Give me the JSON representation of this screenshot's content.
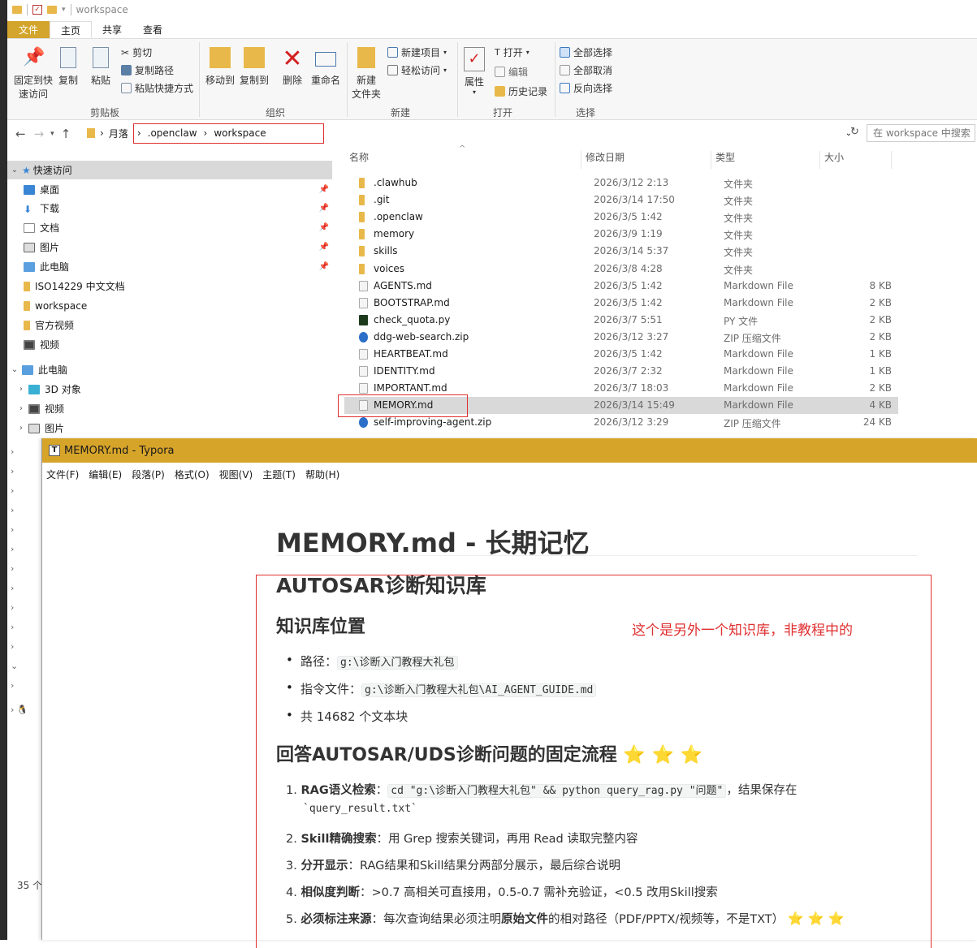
{
  "qat": {
    "title": "workspace"
  },
  "ribbon_tabs": [
    "文件",
    "主页",
    "共享",
    "查看"
  ],
  "ribbon": {
    "pin_line1": "固定到快",
    "pin_line2": "速访问",
    "copy": "复制",
    "paste": "粘贴",
    "cut": "剪切",
    "copy_path": "复制路径",
    "paste_shortcut": "粘贴快捷方式",
    "move_to": "移动到",
    "copy_to": "复制到",
    "delete": "删除",
    "rename": "重命名",
    "new_folder_line1": "新建",
    "new_folder_line2": "文件夹",
    "new_item": "新建项目",
    "easy_access": "轻松访问",
    "properties": "属性",
    "open": "打开",
    "edit": "编辑",
    "history": "历史记录",
    "select_all": "全部选择",
    "select_none": "全部取消",
    "invert_select": "反向选择",
    "groups": [
      "剪贴板",
      "组织",
      "新建",
      "打开",
      "选择"
    ]
  },
  "address": {
    "crumbs": [
      "月落",
      ".openclaw",
      "workspace"
    ],
    "search_placeholder": "在 workspace 中搜索"
  },
  "nav": {
    "quick_access": "快速访问",
    "items": [
      "桌面",
      "下载",
      "文档",
      "图片",
      "此电脑",
      "ISO14229 中文文档",
      "workspace",
      "官方视频",
      "视频"
    ],
    "this_pc": "此电脑",
    "pc_items": [
      "3D 对象",
      "视频",
      "图片"
    ],
    "count": "35 个"
  },
  "columns": {
    "name": "名称",
    "date": "修改日期",
    "type": "类型",
    "size": "大小"
  },
  "files": [
    {
      "name": ".clawhub",
      "date": "2026/3/12 2:13",
      "type": "文件夹",
      "size": ""
    },
    {
      "name": ".git",
      "date": "2026/3/14 17:50",
      "type": "文件夹",
      "size": ""
    },
    {
      "name": ".openclaw",
      "date": "2026/3/5 1:42",
      "type": "文件夹",
      "size": ""
    },
    {
      "name": "memory",
      "date": "2026/3/9 1:19",
      "type": "文件夹",
      "size": ""
    },
    {
      "name": "skills",
      "date": "2026/3/14 5:37",
      "type": "文件夹",
      "size": ""
    },
    {
      "name": "voices",
      "date": "2026/3/8 4:28",
      "type": "文件夹",
      "size": ""
    },
    {
      "name": "AGENTS.md",
      "date": "2026/3/5 1:42",
      "type": "Markdown File",
      "size": "8 KB"
    },
    {
      "name": "BOOTSTRAP.md",
      "date": "2026/3/5 1:42",
      "type": "Markdown File",
      "size": "2 KB"
    },
    {
      "name": "check_quota.py",
      "date": "2026/3/7 5:51",
      "type": "PY 文件",
      "size": "2 KB"
    },
    {
      "name": "ddg-web-search.zip",
      "date": "2026/3/12 3:27",
      "type": "ZIP 压缩文件",
      "size": "2 KB"
    },
    {
      "name": "HEARTBEAT.md",
      "date": "2026/3/5 1:42",
      "type": "Markdown File",
      "size": "1 KB"
    },
    {
      "name": "IDENTITY.md",
      "date": "2026/3/7 2:32",
      "type": "Markdown File",
      "size": "1 KB"
    },
    {
      "name": "IMPORTANT.md",
      "date": "2026/3/7 18:03",
      "type": "Markdown File",
      "size": "2 KB"
    },
    {
      "name": "MEMORY.md",
      "date": "2026/3/14 15:49",
      "type": "Markdown File",
      "size": "4 KB"
    },
    {
      "name": "self-improving-agent.zip",
      "date": "2026/3/12 3:29",
      "type": "ZIP 压缩文件",
      "size": "24 KB"
    }
  ],
  "typora": {
    "title": "MEMORY.md - Typora",
    "menu": [
      "文件(F)",
      "编辑(E)",
      "段落(P)",
      "格式(O)",
      "视图(V)",
      "主题(T)",
      "帮助(H)"
    ],
    "h1": "MEMORY.md - 长期记忆",
    "h2_kb": "AUTOSAR诊断知识库",
    "h3_loc": "知识库位置",
    "note": "这个是另外一个知识库，非教程中的",
    "loc_items": [
      {
        "label": "路径：",
        "code": "g:\\诊断入门教程大礼包"
      },
      {
        "label": "指令文件：",
        "code": "g:\\诊断入门教程大礼包\\AI_AGENT_GUIDE.md"
      },
      {
        "label": "共 14682 个文本块",
        "code": ""
      }
    ],
    "h3_flow": "回答AUTOSAR/UDS诊断问题的固定流程",
    "stars": "⭐ ⭐ ⭐",
    "flow": [
      {
        "n": "1.",
        "bold": "RAG语义检索",
        "text": "：",
        "code": "cd \"g:\\诊断入门教程大礼包\" && python query_rag.py \"问题\"",
        "tail": "，结果保存在",
        "code2": "`query_result.txt`"
      },
      {
        "n": "2.",
        "bold": "Skill精确搜索",
        "text": "：用 Grep 搜索关键词，再用 Read 读取完整内容"
      },
      {
        "n": "3.",
        "bold": "分开显示",
        "text": "：RAG结果和Skill结果分两部分展示，最后综合说明"
      },
      {
        "n": "4.",
        "bold": "相似度判断",
        "text": "：>0.7 高相关可直接用，0.5-0.7 需补充验证，<0.5 改用Skill搜索"
      },
      {
        "n": "5.",
        "bold": "必须标注来源",
        "text": "：每次查询结果必须注明",
        "bold2": "原始文件",
        "tail": "的相对路径（PDF/PPTX/视频等，不是TXT）"
      }
    ]
  },
  "colors": {
    "accent": "#d7a42a",
    "annotation_red": "#e03030",
    "folder": "#e8b84a"
  }
}
